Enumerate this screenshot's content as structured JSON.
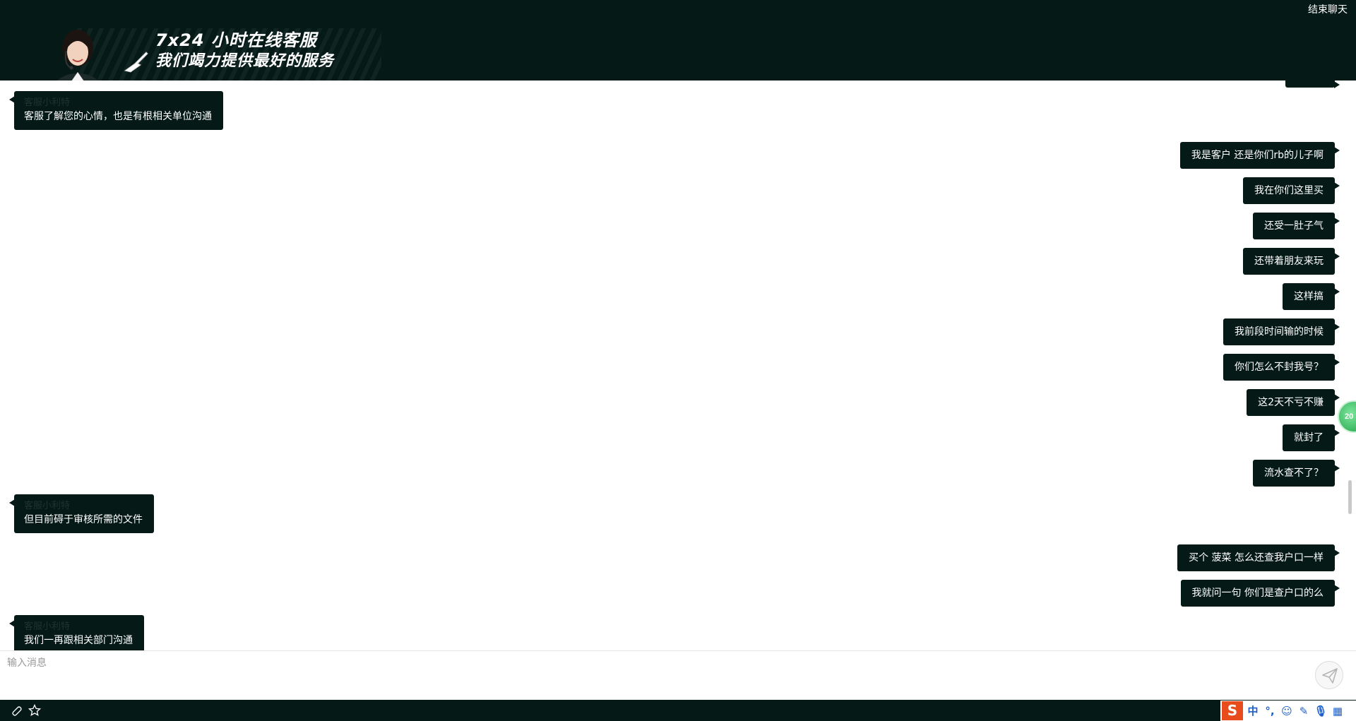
{
  "header": {
    "slogan_line1": "7x24 小时在线客服",
    "slogan_line2": "我们竭力提供最好的服务",
    "end_chat_label": "结束聊天"
  },
  "messages": [
    {
      "side": "left",
      "sender": "客服小利特",
      "text": "客服了解您的心情，也是有根相关单位沟通"
    },
    {
      "side": "right",
      "text": "我是客户 还是你们rb的儿子啊"
    },
    {
      "side": "right",
      "text": "我在你们这里买"
    },
    {
      "side": "right",
      "text": "还受一肚子气"
    },
    {
      "side": "right",
      "text": "还带着朋友来玩"
    },
    {
      "side": "right",
      "text": "这样搞"
    },
    {
      "side": "right",
      "text": "我前段时间输的时候"
    },
    {
      "side": "right",
      "text": "你们怎么不封我号？"
    },
    {
      "side": "right",
      "text": "这2天不亏不赚"
    },
    {
      "side": "right",
      "text": "就封了"
    },
    {
      "side": "right",
      "text": "流水查不了？"
    },
    {
      "side": "left",
      "sender": "客服小利特",
      "text": "但目前碍于审核所需的文件"
    },
    {
      "side": "right",
      "text": "买个 菠菜 怎么还查我户口一样"
    },
    {
      "side": "right",
      "text": "我就问一句 你们是查户口的么"
    },
    {
      "side": "left",
      "sender": "客服小利特",
      "text": "我们一再跟相关部门沟通"
    }
  ],
  "float_badge": "20",
  "input": {
    "placeholder": "输入消息"
  },
  "bottombar": {
    "icons": [
      "paperclip-icon",
      "star-icon"
    ],
    "ime": {
      "logo": "S",
      "items": [
        "中",
        "°,",
        "☺",
        "✎",
        "🎙",
        "▦"
      ]
    }
  },
  "colors": {
    "header_bg": "#051a17",
    "bubble_bg": "#051a17",
    "bubble_text": "#ffffff",
    "ime_logo": "#e84b1c"
  }
}
